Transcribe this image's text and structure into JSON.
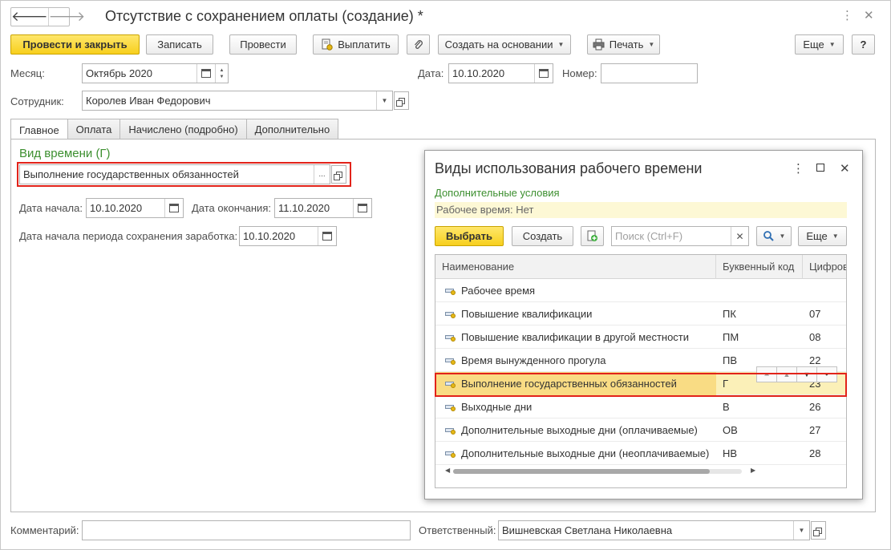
{
  "window": {
    "title": "Отсутствие с сохранением оплаты (создание) *",
    "back_glyph": "🡐",
    "forward_glyph": "🡒",
    "menu_glyph": "⋮",
    "close_glyph": "✕"
  },
  "toolbar": {
    "post_close": "Провести и закрыть",
    "save": "Записать",
    "post": "Провести",
    "pay": "Выплатить",
    "create_based": "Создать на основании",
    "print": "Печать",
    "more": "Еще",
    "help": "?"
  },
  "form": {
    "month_label": "Месяц:",
    "month_value": "Октябрь 2020",
    "date_label": "Дата:",
    "date_value": "10.10.2020",
    "number_label": "Номер:",
    "number_value": "",
    "employee_label": "Сотрудник:",
    "employee_value": "Королев Иван Федорович",
    "comment_label": "Комментарий:",
    "comment_value": "",
    "responsible_label": "Ответственный:",
    "responsible_value": "Вишневская Светлана Николаевна"
  },
  "tabs": [
    {
      "label": "Главное",
      "active": true
    },
    {
      "label": "Оплата"
    },
    {
      "label": "Начислено (подробно)"
    },
    {
      "label": "Дополнительно"
    }
  ],
  "main": {
    "time_type_header": "Вид времени (Г)",
    "time_type_value": "Выполнение государственных обязанностей",
    "select_dots": "...",
    "start_label": "Дата начала:",
    "start_value": "10.10.2020",
    "end_label": "Дата окончания:",
    "end_value": "11.10.2020",
    "earnings_start_label": "Дата начала периода сохранения заработка:",
    "earnings_start_value": "10.10.2020"
  },
  "dialog": {
    "title": "Виды использования рабочего времени",
    "conditions_header": "Дополнительные условия",
    "conditions_value": "Рабочее время: Нет",
    "select_btn": "Выбрать",
    "create_btn": "Создать",
    "search_placeholder": "Поиск (Ctrl+F)",
    "more_btn": "Еще",
    "columns": [
      "Наименование",
      "Буквенный код",
      "Цифрово"
    ],
    "rows": [
      {
        "name": "Рабочее время",
        "code": "",
        "num": ""
      },
      {
        "name": "Повышение квалификации",
        "code": "ПК",
        "num": "07"
      },
      {
        "name": "Повышение квалификации в другой местности",
        "code": "ПМ",
        "num": "08"
      },
      {
        "name": "Время вынужденного прогула",
        "code": "ПВ",
        "num": "22"
      },
      {
        "name": "Выполнение государственных обязанностей",
        "code": "Г",
        "num": "23",
        "selected": true
      },
      {
        "name": "Выходные дни",
        "code": "В",
        "num": "26"
      },
      {
        "name": "Дополнительные выходные дни (оплачиваемые)",
        "code": "ОВ",
        "num": "27"
      },
      {
        "name": "Дополнительные выходные дни (неоплачиваемые)",
        "code": "НВ",
        "num": "28"
      }
    ]
  },
  "colors": {
    "accent_yellow": "#f7cf1d",
    "highlight_red": "#e2231a",
    "green_header": "#3c8f2f",
    "selected_row": "#fbf0b8"
  }
}
